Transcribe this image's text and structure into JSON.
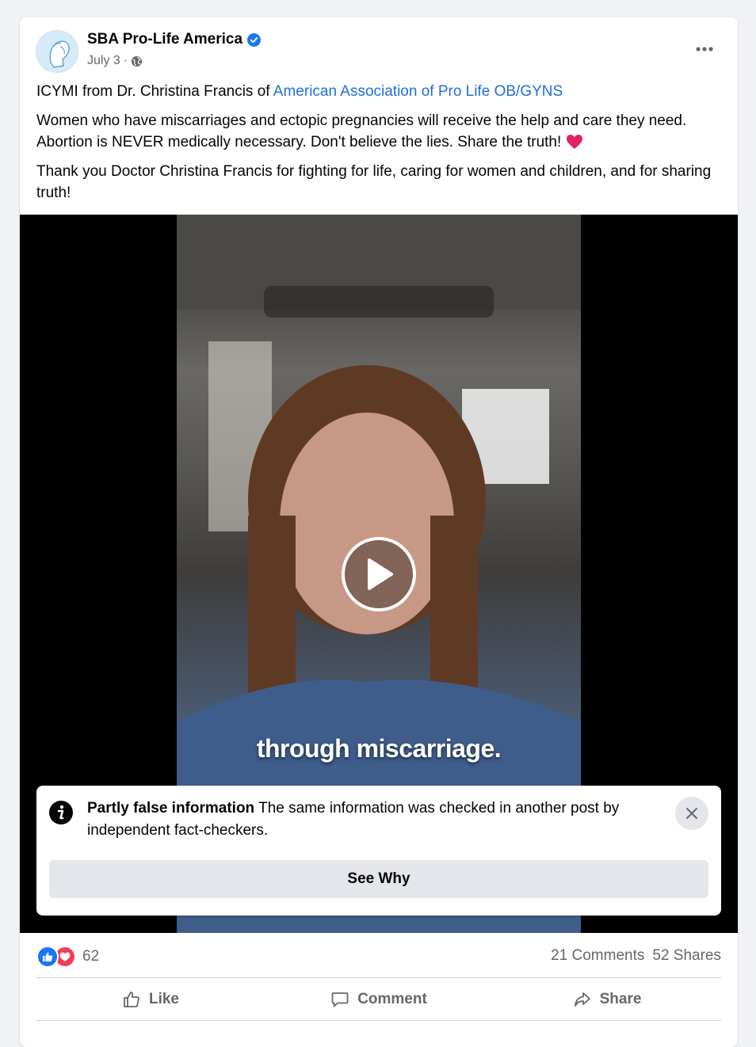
{
  "post": {
    "page_name": "SBA Pro-Life America",
    "date": "July 3",
    "separator": "·",
    "text": {
      "line1_prefix": "ICYMI from Dr. Christina Francis of ",
      "line1_link": "American Association of Pro Life OB/GYNS",
      "para2": "Women who have miscarriages and ectopic pregnancies will receive the help and care they need. Abortion is NEVER medically necessary. Don't believe the lies. Share the truth!",
      "para3": "Thank you Doctor Christina Francis for fighting for life, caring for women and children, and for sharing truth!"
    }
  },
  "video": {
    "caption": "through miscarriage."
  },
  "fact_check": {
    "title": "Partly false information",
    "body": " The same information was checked in another post by independent fact-checkers.",
    "button": "See Why"
  },
  "stats": {
    "reaction_count": "62",
    "comments": "21 Comments",
    "shares": "52 Shares"
  },
  "actions": {
    "like": "Like",
    "comment": "Comment",
    "share": "Share"
  },
  "colors": {
    "link": "#216fdb",
    "verified": "#1877f2",
    "like": "#1877f2",
    "love": "#f33e58"
  }
}
